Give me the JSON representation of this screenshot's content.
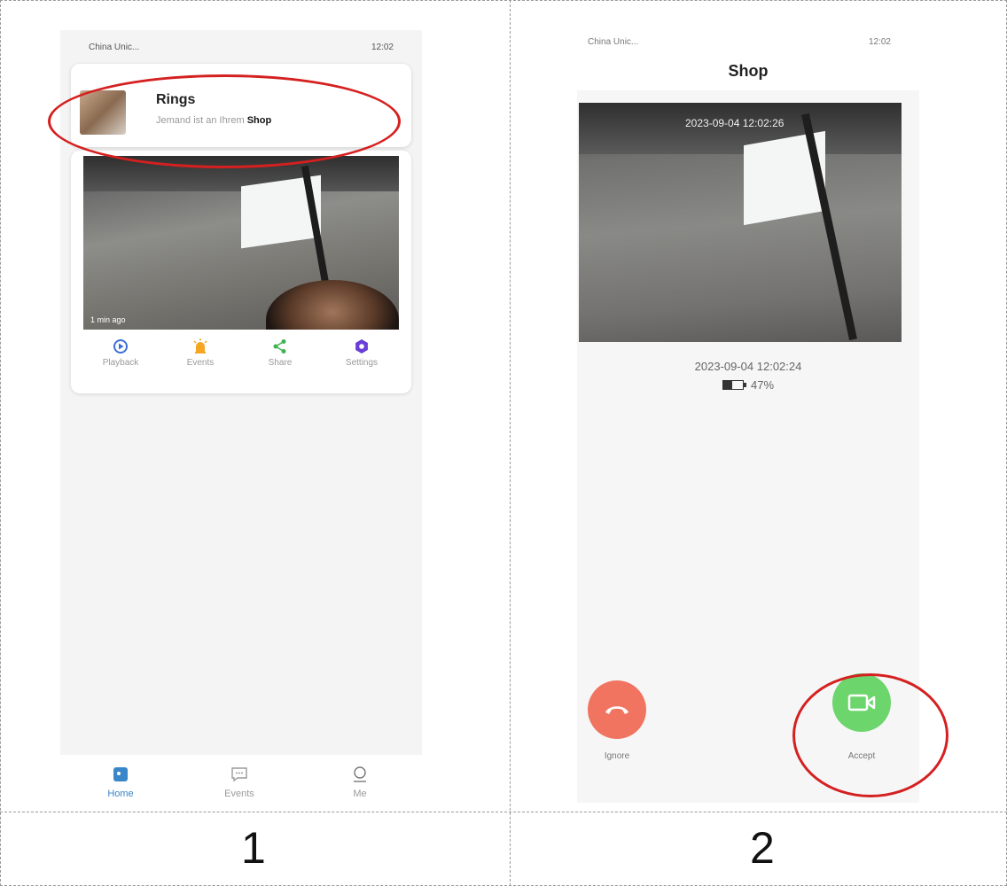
{
  "steps": [
    "1",
    "2"
  ],
  "phone1": {
    "status": {
      "carrier": "China Unic...",
      "time": "12:02"
    },
    "notification": {
      "title": "Rings",
      "body_prefix": "Jemand ist an Ihrem ",
      "body_bold": "Shop"
    },
    "camera": {
      "last_seen": "1 min ago"
    },
    "actions": [
      {
        "label": "Playback",
        "icon": "playback-icon",
        "color": "#3d6fd8"
      },
      {
        "label": "Events",
        "icon": "alarm-icon",
        "color": "#f5a623"
      },
      {
        "label": "Share",
        "icon": "share-icon",
        "color": "#3fb24f"
      },
      {
        "label": "Settings",
        "icon": "gear-icon",
        "color": "#6a3fd8"
      }
    ],
    "tabs": [
      {
        "label": "Home",
        "icon": "home-icon",
        "active": true
      },
      {
        "label": "Events",
        "icon": "chat-icon",
        "active": false
      },
      {
        "label": "Me",
        "icon": "user-icon",
        "active": false
      }
    ],
    "accent": "#3a86c8"
  },
  "phone2": {
    "status": {
      "carrier": "China Unic...",
      "time": "12:02"
    },
    "title": "Shop",
    "camera_timestamp": "2023-09-04 12:02:26",
    "event_time": "2023-09-04 12:02:24",
    "battery": {
      "percent_label": "47%",
      "level": 0.47
    },
    "ignore_label": "Ignore",
    "accept_label": "Accept",
    "colors": {
      "ignore": "#f07460",
      "accept": "#6cd56c"
    }
  }
}
